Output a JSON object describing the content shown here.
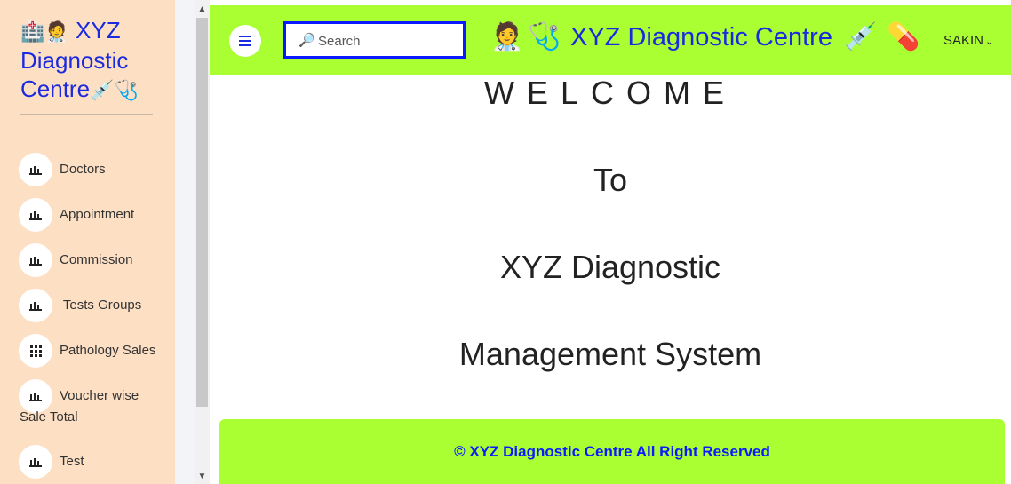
{
  "sidebar": {
    "brand": {
      "line1": "XYZ",
      "line2": "Diagnostic",
      "line3": "Centre"
    },
    "items": [
      {
        "label": "Doctors",
        "icon": "bar-chart-icon"
      },
      {
        "label": "Appointment",
        "icon": "bar-chart-icon"
      },
      {
        "label": "Commission",
        "icon": "bar-chart-icon"
      },
      {
        "label": " Tests Groups",
        "icon": "bar-chart-icon"
      },
      {
        "label": "Pathology Sales",
        "icon": "grid-icon"
      },
      {
        "label": "Voucher wise",
        "label_line2": "Sale Total",
        "icon": "bar-chart-icon"
      },
      {
        "label": "Test",
        "icon": "bar-chart-icon"
      }
    ]
  },
  "header": {
    "search_placeholder": "Search",
    "title": "XYZ Diagnostic Centre",
    "user": "SAKIN"
  },
  "main": {
    "line1": "WELCOME",
    "line2": "To",
    "line3": "XYZ Diagnostic",
    "line4": "Management System"
  },
  "footer": {
    "text": "© XYZ Diagnostic Centre All Right Reserved"
  },
  "colors": {
    "accent": "#aaff33",
    "brand_blue": "#1a2adf",
    "sidebar_bg": "#fddfc4"
  }
}
